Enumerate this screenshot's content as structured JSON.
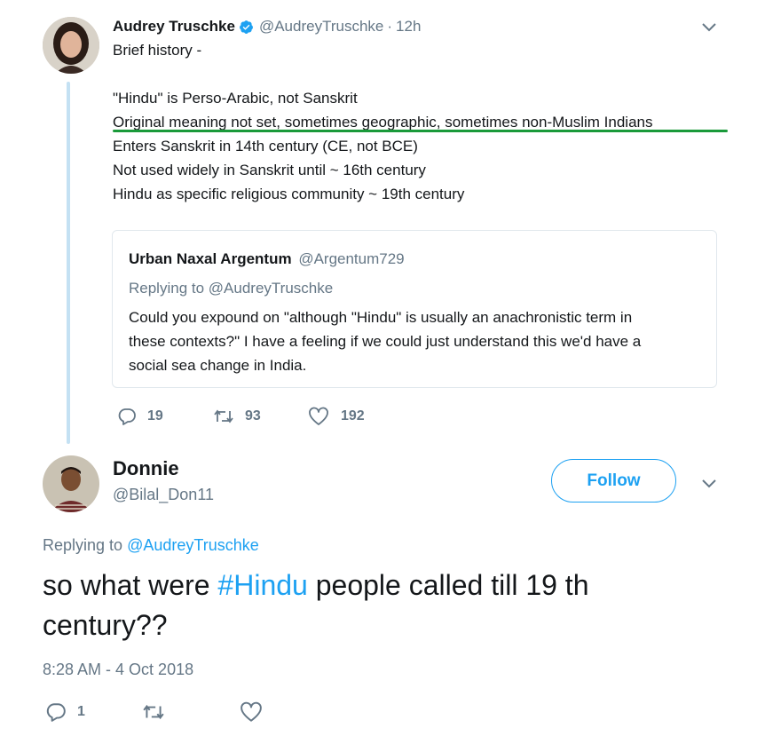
{
  "colors": {
    "accent": "#1da1f2",
    "muted": "#657786",
    "highlight_underline": "#1a9a3a",
    "verified": "#1da1f2"
  },
  "tweet1": {
    "author_name": "Audrey Truschke",
    "handle": "@AudreyTruschke",
    "separator": "·",
    "time": "12h",
    "icons": {
      "verified": "verified-badge-icon",
      "menu": "chevron-down-icon"
    },
    "lines": [
      "Brief history -",
      "\"Hindu\" is Perso-Arabic, not Sanskrit",
      "Original meaning not set, sometimes geographic, sometimes non-Muslim Indians",
      "Enters Sanskrit in 14th century (CE, not BCE)",
      "Not used widely in Sanskrit until ~ 16th century",
      "Hindu as specific religious community ~ 19th century"
    ],
    "quote": {
      "author_name": "Urban Naxal Argentum",
      "handle": "@Argentum729",
      "replying_prefix": "Replying to",
      "replying_handle": "@AudreyTruschke",
      "text_lines": [
        "Could you expound on \"although \"Hindu\" is usually an anachronistic term in",
        "these contexts?\" I have a feeling if we could just understand this we'd have a",
        "social sea change in India."
      ]
    },
    "stats": {
      "replies": "19",
      "retweets": "93",
      "likes": "192"
    }
  },
  "tweet2": {
    "author_name": "Donnie",
    "handle": "@Bilal_Don11",
    "follow_label": "Follow",
    "replying_prefix": "Replying to",
    "replying_handle": "@AudreyTruschke",
    "text_before": "so what were",
    "hashtag": "#Hindu",
    "text_after": "people called till 19 th",
    "text_line2": "century??",
    "timestamp": "8:28 AM - 4 Oct 2018",
    "stats": {
      "replies": "1",
      "retweets": "",
      "likes": ""
    }
  }
}
